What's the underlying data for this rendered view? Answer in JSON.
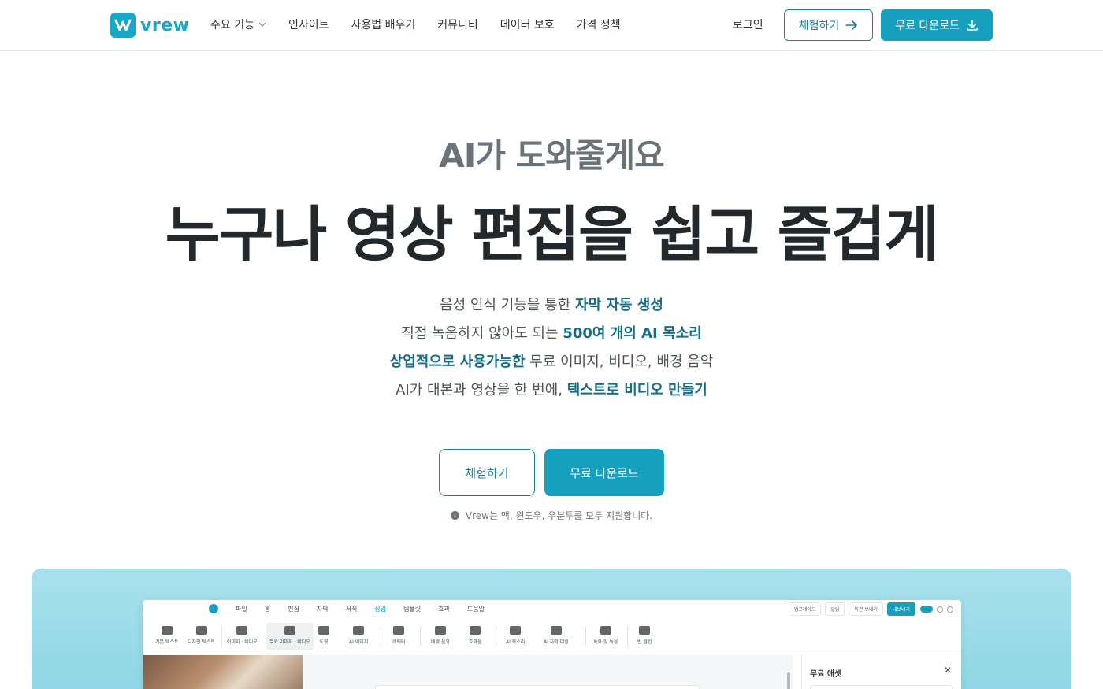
{
  "brand": {
    "name": "vrew",
    "accent": "#16a0bd",
    "dark_accent": "#156e86"
  },
  "nav": {
    "items": [
      {
        "label": "주요 기능",
        "has_dropdown": true
      },
      {
        "label": "인사이트"
      },
      {
        "label": "사용법 배우기"
      },
      {
        "label": "커뮤니티"
      },
      {
        "label": "데이터 보호"
      },
      {
        "label": "가격 정책"
      }
    ],
    "login": "로그인",
    "try_button": "체험하기",
    "download_button": "무료 다운로드"
  },
  "hero": {
    "eyebrow": "AI가 도와줄게요",
    "headline": "누구나 영상 편집을 쉽고 즐겁게",
    "features": [
      {
        "pre": "음성 인식 기능을 통한 ",
        "highlight": "자막 자동 생성",
        "post": ""
      },
      {
        "pre": "직접 녹음하지 않아도 되는 ",
        "highlight": "500여 개의 AI 목소리",
        "post": ""
      },
      {
        "pre": "",
        "highlight": "상업적으로 사용가능한",
        "post": " 무료 이미지, 비디오, 배경 음악"
      },
      {
        "pre": "AI가 대본과 영상을 한 번에, ",
        "highlight": "텍스트로 비디오 만들기",
        "post": ""
      }
    ],
    "try_button": "체험하기",
    "download_button": "무료 다운로드",
    "os_note": "Vrew는 맥, 윈도우, 우분투를 모두 지원합니다."
  },
  "app_preview": {
    "menu": [
      "파일",
      "홈",
      "편집",
      "자막",
      "서식",
      "삽입",
      "템플릿",
      "효과",
      "도움말"
    ],
    "active_menu": "삽입",
    "right_chips": [
      "업그레이드",
      "알림",
      "의견 보내기",
      "내보내기"
    ],
    "tools": [
      "기본 텍스트",
      "디자인 텍스트",
      "이미지 · 비디오",
      "무료 이미지 · 비디오",
      "도형",
      "AI 이미지",
      "캐릭터",
      "배경 음악",
      "효과음",
      "AI 목소리",
      "AI 자막 더빙",
      "녹화 및 녹음",
      "빈 클립"
    ],
    "panel_title": "무료 애셋",
    "panel_close": "✕"
  }
}
